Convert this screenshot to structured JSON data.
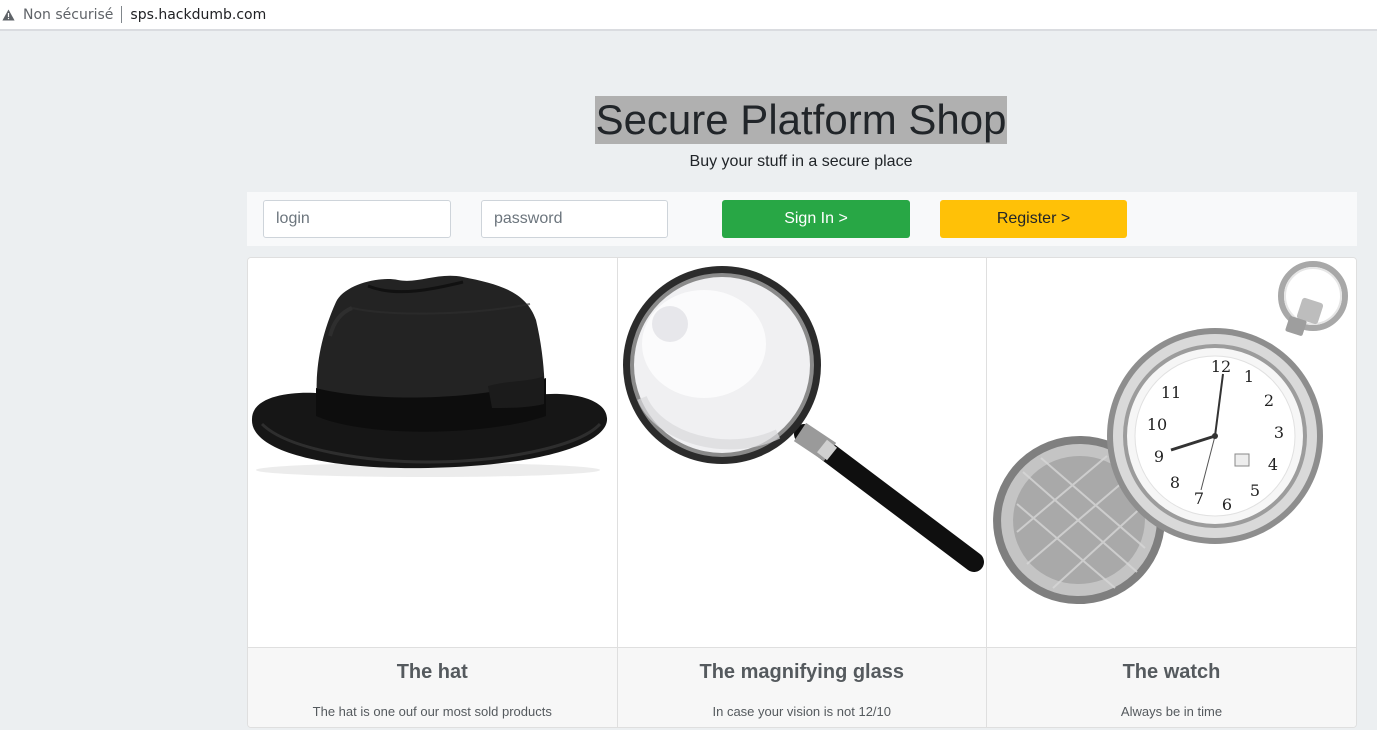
{
  "browser": {
    "security_label": "Non sécurisé",
    "url": "sps.hackdumb.com",
    "warning_icon": "warning-triangle-icon"
  },
  "header": {
    "title": "Secure Platform Shop",
    "subtitle": "Buy your stuff in a secure place"
  },
  "login_form": {
    "login_placeholder": "login",
    "password_placeholder": "password",
    "signin_label": "Sign In >",
    "register_label": "Register >"
  },
  "colors": {
    "signin": "#28a745",
    "register": "#ffc107",
    "title_highlight": "#b0b0b0"
  },
  "products": [
    {
      "image": "hat-image",
      "title": "The hat",
      "description": "The hat is one ouf our most sold products"
    },
    {
      "image": "magnifying-glass-image",
      "title": "The magnifying glass",
      "description": "In case your vision is not 12/10"
    },
    {
      "image": "pocket-watch-image",
      "title": "The watch",
      "description": "Always be in time"
    }
  ]
}
